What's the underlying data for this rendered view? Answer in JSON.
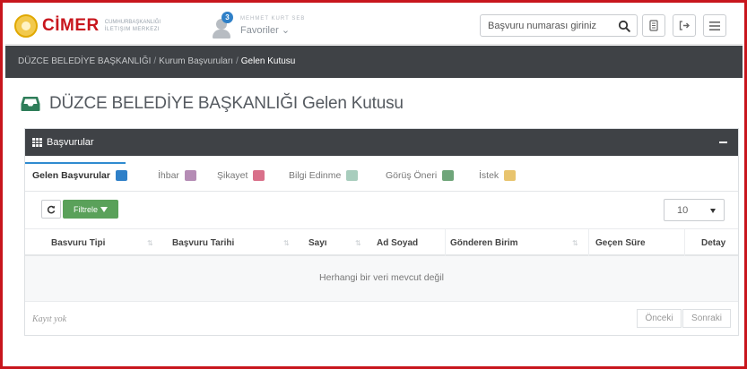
{
  "header": {
    "logo_text": "CİMER",
    "logo_sub_line1": "Cumhurbaşkanlığı",
    "logo_sub_line2": "İletişim Merkezi",
    "user_name": "MEHMET KURT SEB",
    "notification_count": "3",
    "favorites_label": "Favoriler ⌄",
    "search_placeholder": "Başvuru numarası giriniz",
    "icons": [
      "search-icon",
      "document-icon",
      "logout-icon",
      "menu-icon"
    ]
  },
  "breadcrumb": {
    "items": [
      "DÜZCE BELEDİYE BAŞKANLIĞI",
      "Kurum Başvuruları",
      "Gelen Kutusu"
    ],
    "separator": "/"
  },
  "page": {
    "title": "DÜZCE BELEDİYE BAŞKANLIĞI Gelen Kutusu"
  },
  "panel": {
    "title": "Başvurular",
    "tabs": [
      {
        "label": "Gelen Başvurular",
        "color": "#2f80c8",
        "active": true
      },
      {
        "label": "İhbar",
        "color": "#b58cb5"
      },
      {
        "label": "Şikayet",
        "color": "#d9708a"
      },
      {
        "label": "Bilgi Edinme",
        "color": "#a8cdbd"
      },
      {
        "label": "Görüş Öneri",
        "color": "#6fa57a"
      },
      {
        "label": "İstek",
        "color": "#e8c46e"
      }
    ],
    "filter_label": "Filtrele",
    "page_size": "10",
    "columns": [
      "Basvuru Tipi",
      "Başvuru Tarihi",
      "Sayı",
      "Ad Soyad",
      "Gönderen Birim",
      "Geçen Süre",
      "Detay"
    ],
    "sort_glyph": "⇅",
    "empty_message": "Herhangi bir veri mevcut değil",
    "no_record": "Kayıt yok",
    "prev_label": "Önceki",
    "next_label": "Sonraki"
  },
  "colors": {
    "frame_red": "#c8161d",
    "dark_bar": "#3f4246",
    "filter_green": "#5aa15a",
    "accent_blue": "#2f8bd0"
  }
}
